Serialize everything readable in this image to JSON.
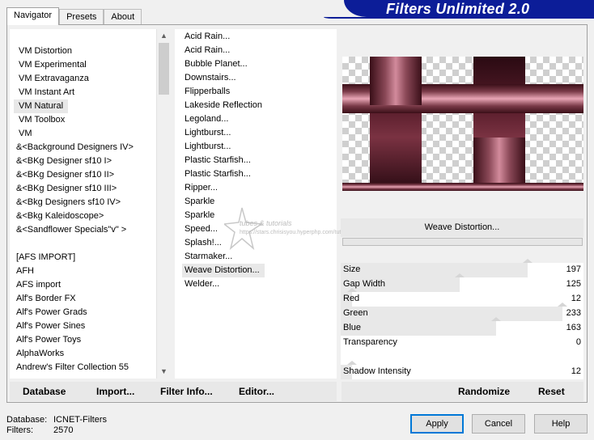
{
  "app": {
    "title": "Filters Unlimited 2.0",
    "tabs": [
      "Navigator",
      "Presets",
      "About"
    ],
    "active_tab": "Navigator"
  },
  "categories": {
    "selected": "VM Natural",
    "items": [
      "VM Distortion",
      "VM Experimental",
      "VM Extravaganza",
      "VM Instant Art",
      "VM Natural",
      "VM Toolbox",
      "VM",
      "&<Background Designers IV>",
      "&<BKg Designer sf10 I>",
      "&<BKg Designer sf10 II>",
      "&<BKg Designer sf10 III>",
      "&<Bkg Designers sf10 IV>",
      "&<Bkg Kaleidoscope>",
      "&<Sandflower Specials\"v\" >",
      "[AFS IMPORT]",
      "AFH",
      "AFS import",
      "Alf's Border FX",
      "Alf's Power Grads",
      "Alf's Power Sines",
      "Alf's Power Toys",
      "AlphaWorks",
      "Andrew's Filter Collection 55"
    ]
  },
  "filters": {
    "selected": "Weave Distortion...",
    "items": [
      "Acid Rain...",
      "Acid Rain...",
      "Bubble Planet...",
      "Downstairs...",
      "Flipperballs",
      "Lakeside Reflection",
      "Legoland...",
      "Lightburst...",
      "Lightburst...",
      "Plastic Starfish...",
      "Plastic Starfish...",
      "Ripper...",
      "Sparkle",
      "Sparkle",
      "Speed...",
      "Splash!...",
      "Starmaker...",
      "Weave Distortion...",
      "Welder..."
    ]
  },
  "watermark": {
    "text1": "tubes & tutorials",
    "text2": "https://stars.chrisisyou.hyperphp.com/tutoriales/"
  },
  "preview": {
    "filter_name": "Weave Distortion...",
    "colors": {
      "dark": "#3a0f18",
      "light": "#e8a5b5"
    }
  },
  "parameters": [
    {
      "name": "Size",
      "value": "197",
      "level": 197
    },
    {
      "name": "Gap Width",
      "value": "125",
      "level": 125
    },
    {
      "name": "Red",
      "value": "12",
      "level": 12
    },
    {
      "name": "Green",
      "value": "233",
      "level": 233
    },
    {
      "name": "Blue",
      "value": "163",
      "level": 163
    },
    {
      "name": "Transparency",
      "value": "0",
      "level": 0
    },
    {
      "name": "",
      "value": "",
      "level": 0
    },
    {
      "name": "Shadow Intensity",
      "value": "12",
      "level": 12
    }
  ],
  "toolbar": {
    "database": "Database",
    "import": "Import...",
    "filter_info": "Filter Info...",
    "editor": "Editor...",
    "randomize": "Randomize",
    "reset": "Reset"
  },
  "status": {
    "database_label": "Database:",
    "database_value": "ICNET-Filters",
    "filters_label": "Filters:",
    "filters_value": "2570"
  },
  "buttons": {
    "apply": "Apply",
    "cancel": "Cancel",
    "help": "Help"
  },
  "colors": {
    "banner": "#0c1d98",
    "selection": "#e8e8e8",
    "primary_button_border": "#0078d7"
  }
}
